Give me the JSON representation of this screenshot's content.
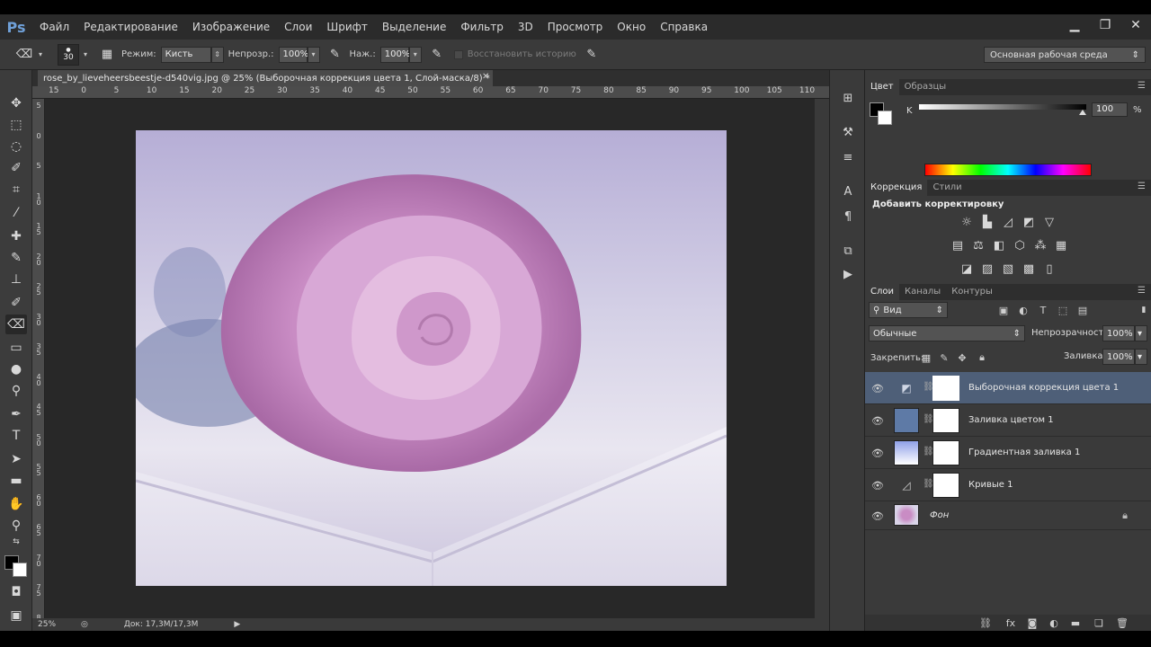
{
  "app": {
    "logo": "Ps"
  },
  "menu": [
    "Файл",
    "Редактирование",
    "Изображение",
    "Слои",
    "Шрифт",
    "Выделение",
    "Фильтр",
    "3D",
    "Просмотр",
    "Окно",
    "Справка"
  ],
  "window_controls": {
    "minimize": "▁",
    "restore": "❐",
    "close": "✕"
  },
  "options": {
    "brush_size": "30",
    "mode_label": "Режим:",
    "mode_value": "Кисть",
    "opacity_label": "Непрозр.:",
    "opacity_value": "100%",
    "pressure_label": "Наж.:",
    "pressure_value": "100%",
    "history_label": "Восстановить историю",
    "workspace": "Основная рабочая среда"
  },
  "document": {
    "tab_title": "rose_by_lieveheersbeestje-d540vig.jpg @ 25% (Выборочная коррекция цвета 1, Слой-маска/8) *",
    "ruler_top": [
      "15",
      "0",
      "5",
      "10",
      "15",
      "20",
      "25",
      "30",
      "35",
      "40",
      "45",
      "50",
      "55",
      "60",
      "65",
      "70",
      "75",
      "80",
      "85",
      "90",
      "95",
      "100",
      "105",
      "110"
    ],
    "ruler_left": [
      "5",
      "0",
      "5",
      "1\n0",
      "1\n5",
      "2\n0",
      "2\n5",
      "3\n0",
      "3\n5",
      "4\n0",
      "4\n5",
      "5\n0",
      "5\n5",
      "6\n0",
      "6\n5",
      "7\n0",
      "7\n5",
      "8\n0"
    ],
    "zoom": "25%",
    "doc_size": "Док: 17,3M/17,3M"
  },
  "color_panel": {
    "tabs": [
      "Цвет",
      "Образцы"
    ],
    "channel_label": "K",
    "channel_value": "100",
    "unit": "%",
    "k_level": 0.98
  },
  "adjustments_panel": {
    "tabs": [
      "Коррекция",
      "Стили"
    ],
    "title": "Добавить корректировку"
  },
  "layers_panel": {
    "tabs": [
      "Слои",
      "Каналы",
      "Контуры"
    ],
    "filter_label": "Вид",
    "blend_mode": "Обычные",
    "opacity_label": "Непрозрачность:",
    "opacity_value": "100%",
    "lock_label": "Закрепить:",
    "fill_label": "Заливка:",
    "fill_value": "100%",
    "layers": [
      {
        "name": "Выборочная коррекция цвета 1",
        "selected": true
      },
      {
        "name": "Заливка цветом 1",
        "selected": false
      },
      {
        "name": "Градиентная заливка 1",
        "selected": false
      },
      {
        "name": "Кривые 1",
        "selected": false
      },
      {
        "name": "Фон",
        "selected": false
      }
    ]
  },
  "colors": {
    "selection": "#4e5f78",
    "fill_swatch": "#5e7aa6",
    "rose": "#c98cc4"
  }
}
